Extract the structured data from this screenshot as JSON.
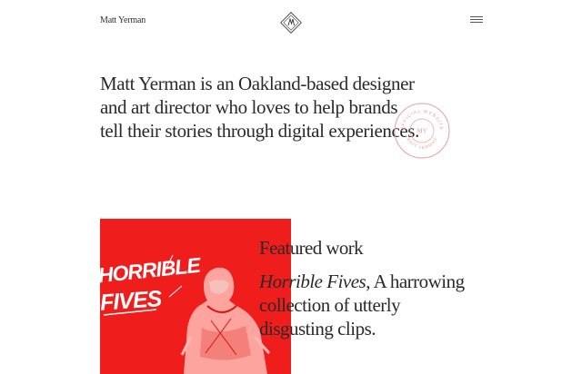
{
  "header": {
    "site_name": "Matt Yerman",
    "logo_icon": "diamond-monogram-logo",
    "menu_icon": "hamburger-menu-icon"
  },
  "intro": {
    "lines": [
      "Matt Yerman is an Oakland-based designer",
      "and art director who loves to help brands",
      "tell their stories through digital experiences."
    ]
  },
  "stamp": {
    "top_text": "OFFICIAL WEBSITE",
    "bottom_text": "MATT YERMAN",
    "center_text": "MY"
  },
  "featured": {
    "heading": "Featured work",
    "project_title": "Horrible Fives",
    "description_lines": [
      ", A harrowing",
      "collection of utterly",
      "disgusting clips."
    ],
    "image_text_1": "HORRIBLE",
    "image_text_2": "FIVES"
  },
  "colors": {
    "accent_red": "#f01d1d",
    "stamp_red": "#e9a0a0",
    "text": "#2a2a2a"
  }
}
